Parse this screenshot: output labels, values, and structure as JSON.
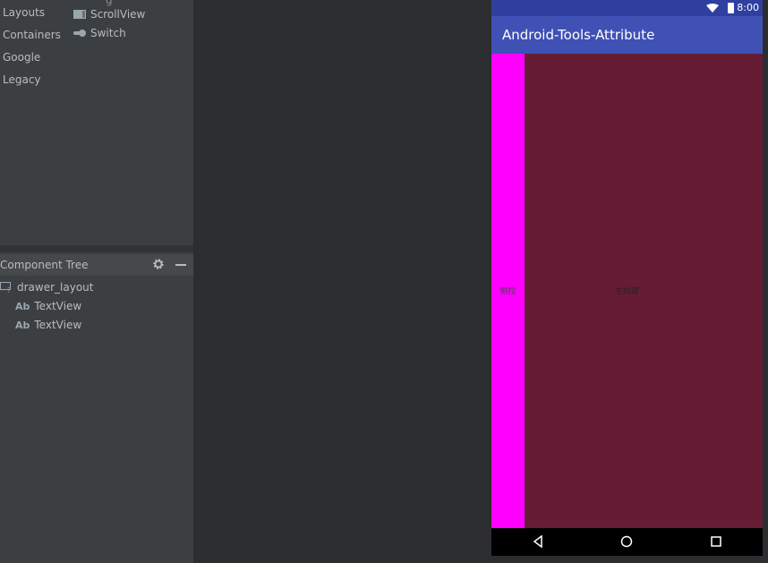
{
  "palette": {
    "categories": [
      "Layouts",
      "Containers",
      "Google",
      "Legacy"
    ],
    "partial_item": "g",
    "items": [
      {
        "label": "ScrollView",
        "icon": "scrollview-icon"
      },
      {
        "label": "Switch",
        "icon": "switch-icon"
      }
    ]
  },
  "component_tree": {
    "title": "Component Tree",
    "nodes": [
      {
        "label": "drawer_layout",
        "icon": "drawer-layout-icon"
      },
      {
        "label": "TextView",
        "icon": "ab-textview-icon",
        "prefix": "Ab"
      },
      {
        "label": "TextView",
        "icon": "ab-textview-icon",
        "prefix": "Ab"
      }
    ]
  },
  "device": {
    "status_time": "8:00",
    "app_title": "Android-Tools-Attribute",
    "drawer_text": "侧拉",
    "main_text": "主内容",
    "colors": {
      "status_bar": "#303f9f",
      "app_bar": "#3f51b5",
      "drawer": "#ff00ff",
      "content": "#661c35"
    }
  }
}
